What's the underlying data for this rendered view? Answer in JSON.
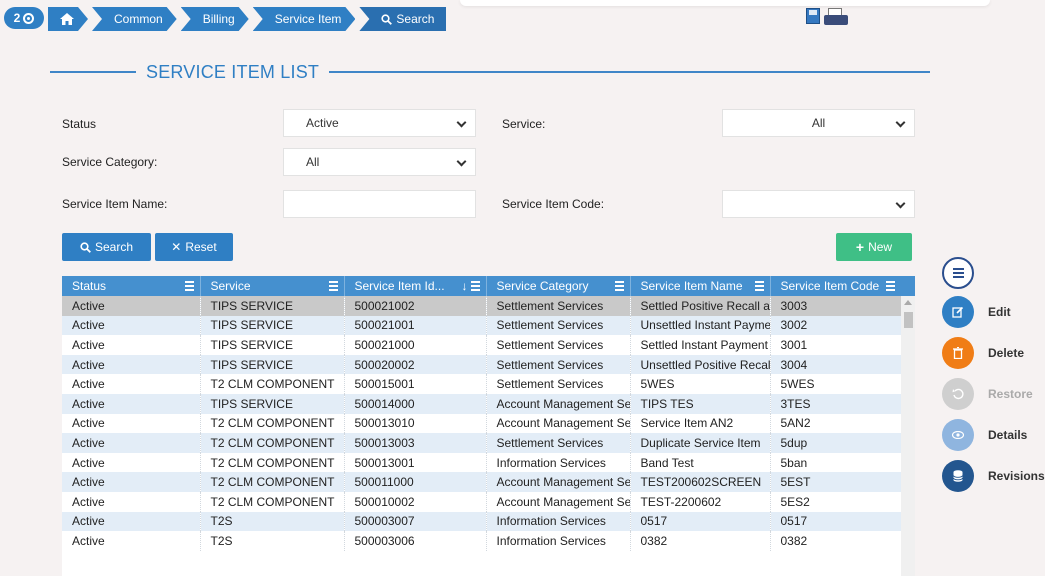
{
  "header": {
    "badge_count": "2",
    "breadcrumbs": [
      "Common",
      "Billing",
      "Service Item",
      "Search"
    ]
  },
  "page_title": "SERVICE ITEM LIST",
  "filters": {
    "status_label": "Status",
    "status_value": "Active",
    "service_label": "Service:",
    "service_value": "All",
    "category_label": "Service Category:",
    "category_value": "All",
    "item_name_label": "Service Item Name:",
    "item_name_value": "",
    "item_code_label": "Service Item Code:",
    "item_code_value": ""
  },
  "buttons": {
    "search": "Search",
    "reset": "Reset",
    "new": "New"
  },
  "table": {
    "columns": [
      "Status",
      "Service",
      "Service Item Id...",
      "Service Category",
      "Service Item Name",
      "Service Item Code"
    ],
    "rows": [
      [
        "Active",
        "TIPS SERVICE",
        "500021002",
        "Settlement Services",
        "Settled Positive Recall a",
        "3003"
      ],
      [
        "Active",
        "TIPS SERVICE",
        "500021001",
        "Settlement Services",
        "Unsettled Instant Payme",
        "3002"
      ],
      [
        "Active",
        "TIPS SERVICE",
        "500021000",
        "Settlement Services",
        "Settled Instant Payment",
        "3001"
      ],
      [
        "Active",
        "TIPS SERVICE",
        "500020002",
        "Settlement Services",
        "Unsettled Positive Recal",
        "3004"
      ],
      [
        "Active",
        "T2 CLM COMPONENT",
        "500015001",
        "Settlement Services",
        "5WES",
        "5WES"
      ],
      [
        "Active",
        "TIPS SERVICE",
        "500014000",
        "Account Management Se",
        "TIPS TES",
        "3TES"
      ],
      [
        "Active",
        "T2 CLM COMPONENT",
        "500013010",
        "Account Management Se",
        "Service Item AN2",
        "5AN2"
      ],
      [
        "Active",
        "T2 CLM COMPONENT",
        "500013003",
        "Settlement Services",
        "Duplicate Service Item",
        "5dup"
      ],
      [
        "Active",
        "T2 CLM COMPONENT",
        "500013001",
        "Information Services",
        "Band Test",
        "5ban"
      ],
      [
        "Active",
        "T2 CLM COMPONENT",
        "500011000",
        "Account Management Se",
        "TEST200602SCREEN",
        "5EST"
      ],
      [
        "Active",
        "T2 CLM COMPONENT",
        "500010002",
        "Account Management Se",
        "TEST-2200602",
        "5ES2"
      ],
      [
        "Active",
        "T2S",
        "500003007",
        "Information Services",
        "0517",
        "0517"
      ],
      [
        "Active",
        "T2S",
        "500003006",
        "Information Services",
        "0382",
        "0382"
      ]
    ]
  },
  "actions": {
    "edit": "Edit",
    "delete": "Delete",
    "restore": "Restore",
    "details": "Details",
    "revisions": "Revisions"
  },
  "colors": {
    "primary": "#2f7fc4",
    "header_row": "#4590cf",
    "new_button": "#3fbf86",
    "delete": "#f07d16",
    "revisions": "#23568f"
  }
}
